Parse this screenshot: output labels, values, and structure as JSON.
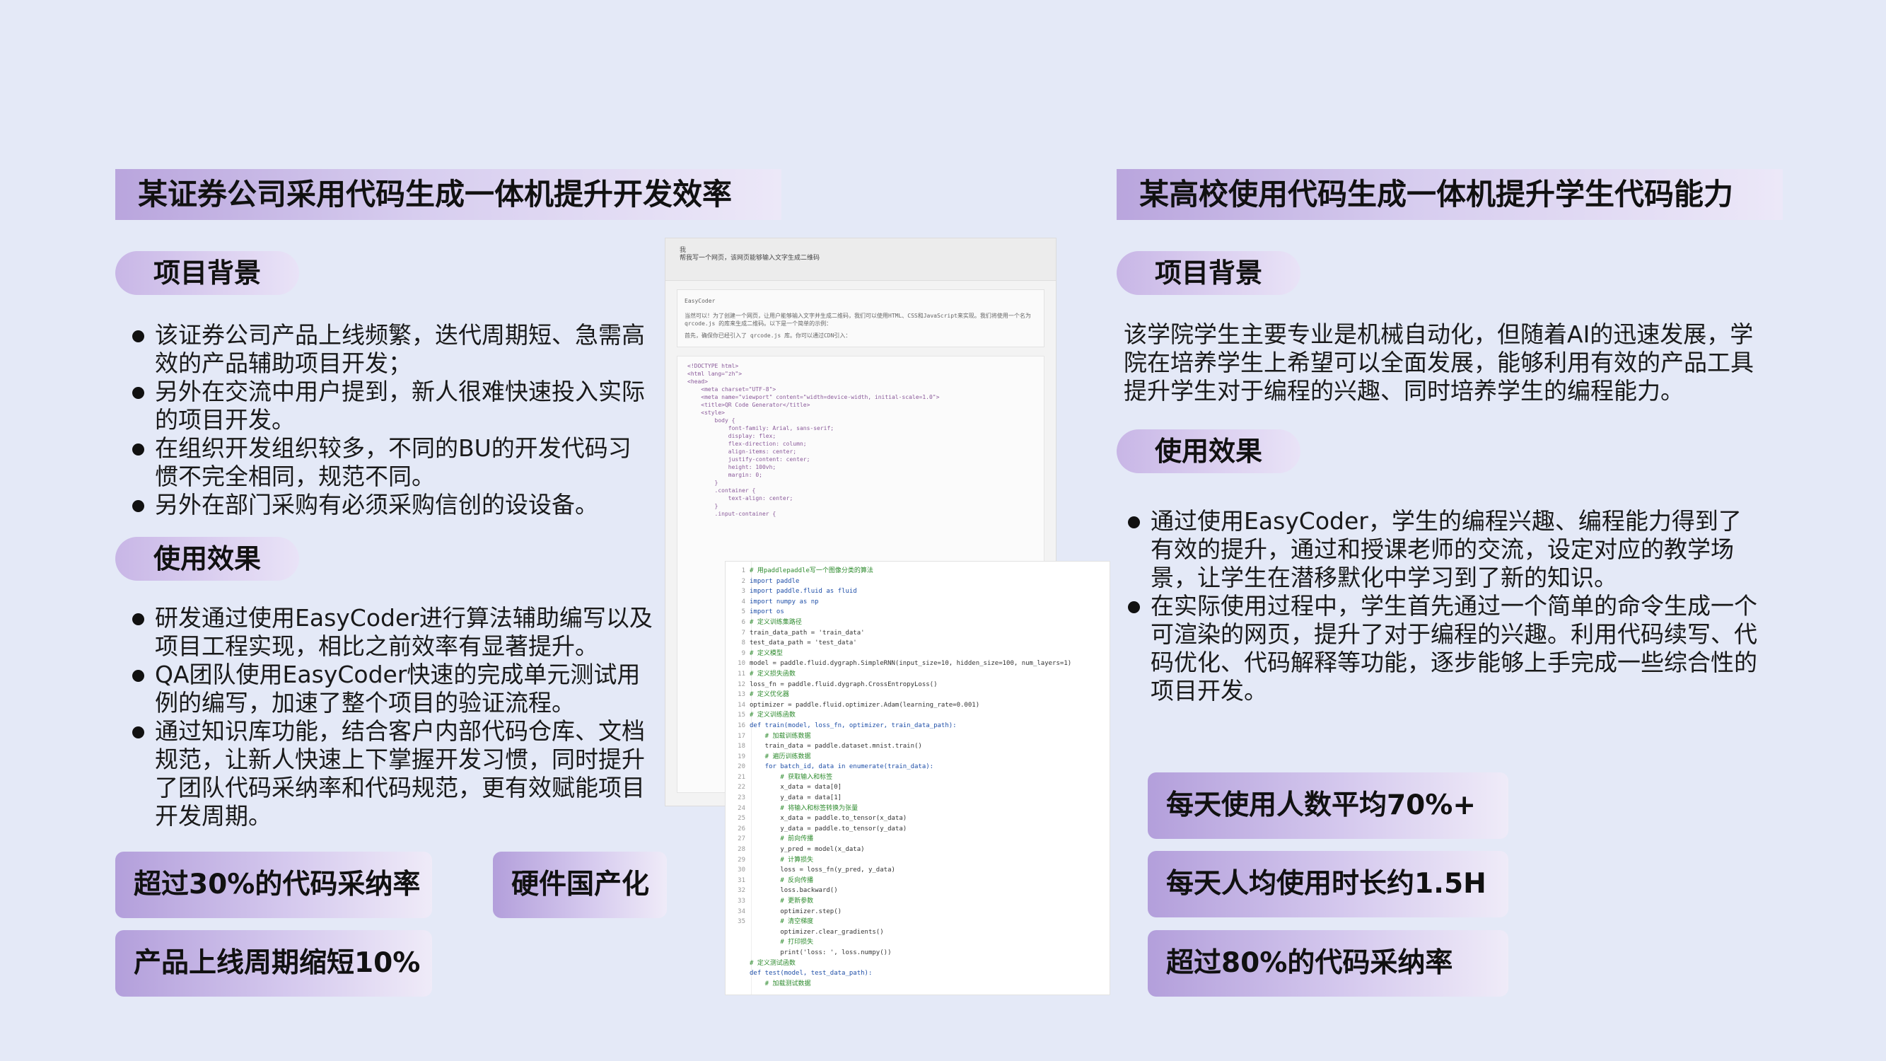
{
  "left": {
    "title": "某证券公司采用代码生成一体机提升开发效率",
    "background_label": "项目背景",
    "background_items": [
      "该证券公司产品上线频繁，迭代周期短、急需高效的产品辅助项目开发；",
      "另外在交流中用户提到，新人很难快速投入实际的项目开发。",
      "在组织开发组织较多，不同的BU的开发代码习惯不完全相同，规范不同。",
      "另外在部门采购有必须采购信创的设设备。"
    ],
    "effect_label": "使用效果",
    "effect_items": [
      "研发通过使用EasyCoder进行算法辅助编写以及项目工程实现，相比之前效率有显著提升。",
      "QA团队使用EasyCoder快速的完成单元测试用例的编写，加速了整个项目的验证流程。",
      "通过知识库功能，结合客户内部代码仓库、文档规范，让新人快速上下掌握开发习惯，同时提升了团队代码采纳率和代码规范，更有效赋能项目开发周期。"
    ],
    "stats": [
      "超过30%的代码采纳率",
      "硬件国产化",
      "产品上线周期缩短10%"
    ]
  },
  "right": {
    "title": "某高校使用代码生成一体机提升学生代码能力",
    "background_label": "项目背景",
    "background_text": "该学院学生主要专业是机械自动化，但随着AI的迅速发展，学院在培养学生上希望可以全面发展，能够利用有效的产品工具提升学生对于编程的兴趣、同时培养学生的编程能力。",
    "effect_label": "使用效果",
    "effect_items": [
      "通过使用EasyCoder，学生的编程兴趣、编程能力得到了有效的提升，通过和授课老师的交流，设定对应的教学场景，让学生在潜移默化中学习到了新的知识。",
      "在实际使用过程中，学生首先通过一个简单的命令生成一个可渲染的网页，提升了对于编程的兴趣。利用代码续写、代码优化、代码解释等功能，逐步能够上手完成一些综合性的项目开发。"
    ],
    "stats": [
      "每天使用人数平均70%+",
      "每天人均使用时长约1.5H",
      "超过80%的代码采纳率"
    ]
  },
  "screenshots": {
    "chat_user": "我",
    "chat_prompt": "帮我写一个网页，该网页能够输入文字生成二维码",
    "chat_assistant": "EasyCoder",
    "chat_reply": "当然可以！为了创建一个网页，让用户能够输入文字并生成二维码，我们可以使用HTML、CSS和JavaScript来实现。我们将使用一个名为 qrcode.js 的库来生成二维码。以下是一个简单的示例：",
    "chat_reply2": "首先，确保你已经引入了 qrcode.js 库。你可以通过CDN引入：",
    "html_code": "<!DOCTYPE html>\n<html lang=\"zh\">\n<head>\n    <meta charset=\"UTF-8\">\n    <meta name=\"viewport\" content=\"width=device-width, initial-scale=1.0\">\n    <title>QR Code Generator</title>\n    <style>\n        body {\n            font-family: Arial, sans-serif;\n            display: flex;\n            flex-direction: column;\n            align-items: center;\n            justify-content: center;\n            height: 100vh;\n            margin: 0;\n        }\n        .container {\n            text-align: center;\n        }\n        .input-container {",
    "py_lines": [
      "# 用paddlepaddle写一个图像分类的算法",
      "import paddle",
      "import paddle.fluid as fluid",
      "import numpy as np",
      "import os",
      "# 定义训练集路径",
      "train_data_path = 'train_data'",
      "test_data_path = 'test_data'",
      "# 定义模型",
      "model = paddle.fluid.dygraph.SimpleRNN(input_size=10, hidden_size=100, num_layers=1)",
      "# 定义损失函数",
      "loss_fn = paddle.fluid.dygraph.CrossEntropyLoss()",
      "# 定义优化器",
      "optimizer = paddle.fluid.optimizer.Adam(learning_rate=0.001)",
      "# 定义训练函数",
      "def train(model, loss_fn, optimizer, train_data_path):",
      "    # 加载训练数据",
      "    train_data = paddle.dataset.mnist.train()",
      "    # 遍历训练数据",
      "    for batch_id, data in enumerate(train_data):",
      "        # 获取输入和标签",
      "        x_data = data[0]",
      "        y_data = data[1]",
      "        # 将输入和标签转换为张量",
      "        x_data = paddle.to_tensor(x_data)",
      "        y_data = paddle.to_tensor(y_data)",
      "        # 前向传播",
      "        y_pred = model(x_data)",
      "        # 计算损失",
      "        loss = loss_fn(y_pred, y_data)",
      "        # 反向传播",
      "        loss.backward()",
      "        # 更新参数",
      "        optimizer.step()",
      "        # 清空梯度",
      "        optimizer.clear_gradients()",
      "        # 打印损失",
      "        print('loss: ', loss.numpy())",
      "# 定义测试函数",
      "def test(model, test_data_path):",
      "    # 加载测试数据"
    ]
  }
}
